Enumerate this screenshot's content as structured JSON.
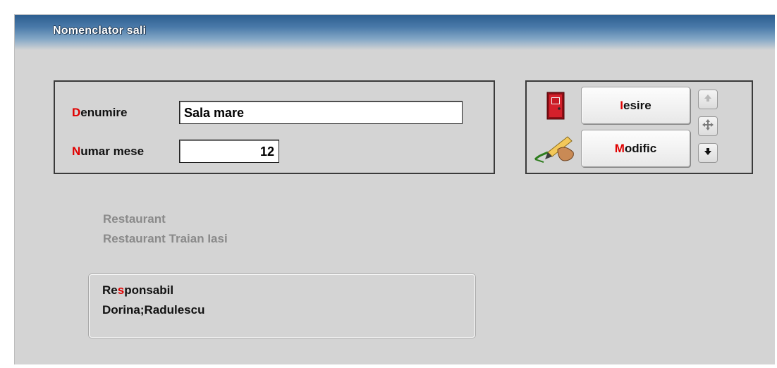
{
  "window": {
    "title": "Nomenclator sali"
  },
  "form": {
    "denumire": {
      "hotkey": "D",
      "rest": "enumire",
      "value": "Sala mare"
    },
    "numar_mese": {
      "hotkey": "N",
      "rest": "umar mese",
      "value": "12"
    }
  },
  "buttons": {
    "iesire": {
      "hotkey": "I",
      "rest": "esire"
    },
    "modific": {
      "hotkey": "M",
      "rest": "odific"
    }
  },
  "info": {
    "line1": "Restaurant",
    "line2": "Restaurant Traian Iasi"
  },
  "responsabil": {
    "label_pre": "Re",
    "label_hot": "s",
    "label_post": "ponsabil",
    "value": "Dorina;Radulescu"
  },
  "colors": {
    "hotkey": "#e00000",
    "title_bar": "#2c5d8f",
    "background": "#d4d4d4"
  },
  "icons": [
    "exit-door-icon",
    "edit-pen-icon",
    "arrow-up-icon",
    "move-icon",
    "arrow-down-icon"
  ]
}
